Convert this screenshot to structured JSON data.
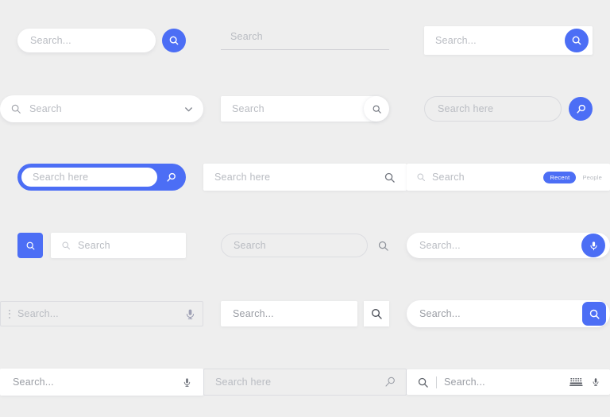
{
  "canvas": {
    "background": "#eeeeee",
    "accent": "#4c6ef5",
    "placeholder_color": "#b9bcc2",
    "columns": 3,
    "rows": 6
  },
  "variants": [
    {
      "id": "v1",
      "name": "pill-input-with-blue-circle-button",
      "placeholder": "Search...",
      "icons": [
        "search-icon"
      ]
    },
    {
      "id": "v2",
      "name": "underline-input",
      "placeholder": "Search",
      "icons": []
    },
    {
      "id": "v3",
      "name": "rect-input-with-blue-circle-button-inside",
      "placeholder": "Search...",
      "icons": [
        "search-icon"
      ]
    },
    {
      "id": "v4",
      "name": "pill-input-with-leading-search-and-chevron",
      "placeholder": "Search",
      "icons": [
        "search-icon",
        "chevron-down-icon"
      ]
    },
    {
      "id": "v5",
      "name": "rect-input-with-white-circle-search-button",
      "placeholder": "Search",
      "icons": [
        "search-icon"
      ]
    },
    {
      "id": "v6",
      "name": "outlined-pill-with-blue-circle-button",
      "placeholder": "Search here",
      "icons": [
        "search-icon"
      ]
    },
    {
      "id": "v7",
      "name": "blue-pill-wrapper-with-white-input",
      "placeholder": "Search here",
      "icons": [
        "search-icon"
      ]
    },
    {
      "id": "v8",
      "name": "rect-input-with-trailing-search-icon",
      "placeholder": "Search here",
      "icons": [
        "search-icon"
      ]
    },
    {
      "id": "v9",
      "name": "rect-input-with-filter-chips",
      "placeholder": "Search",
      "icons": [
        "search-icon"
      ],
      "chips": [
        {
          "label": "Recent",
          "active": true
        },
        {
          "label": "People",
          "active": false
        }
      ]
    },
    {
      "id": "v10",
      "name": "split-blue-square-button-and-input",
      "placeholder": "Search",
      "icons": [
        "search-icon"
      ]
    },
    {
      "id": "v11",
      "name": "outlined-pill-with-external-search-icon",
      "placeholder": "Search",
      "icons": [
        "search-icon"
      ]
    },
    {
      "id": "v12",
      "name": "pill-input-with-blue-mic-button",
      "placeholder": "Search...",
      "icons": [
        "microphone-icon"
      ]
    },
    {
      "id": "v13",
      "name": "bordered-input-with-menu-dots-and-mic",
      "placeholder": "Search...",
      "icons": [
        "more-vertical-icon",
        "microphone-icon"
      ]
    },
    {
      "id": "v14",
      "name": "rect-input-with-separate-square-search-button",
      "placeholder": "Search...",
      "icons": [
        "search-icon"
      ]
    },
    {
      "id": "v15",
      "name": "pill-input-with-blue-rounded-square-search-button",
      "placeholder": "Search...",
      "icons": [
        "search-icon"
      ]
    },
    {
      "id": "v16",
      "name": "rect-input-with-trailing-mic-icon",
      "placeholder": "Search...",
      "icons": [
        "microphone-icon"
      ]
    },
    {
      "id": "v17",
      "name": "bordered-input-with-outline-search-icon",
      "placeholder": "Search here",
      "icons": [
        "search-icon"
      ]
    },
    {
      "id": "v18",
      "name": "full-bar-with-search-divider-keyboard-and-mic",
      "placeholder": "Search...",
      "icons": [
        "search-icon",
        "keyboard-icon",
        "microphone-icon"
      ]
    }
  ]
}
